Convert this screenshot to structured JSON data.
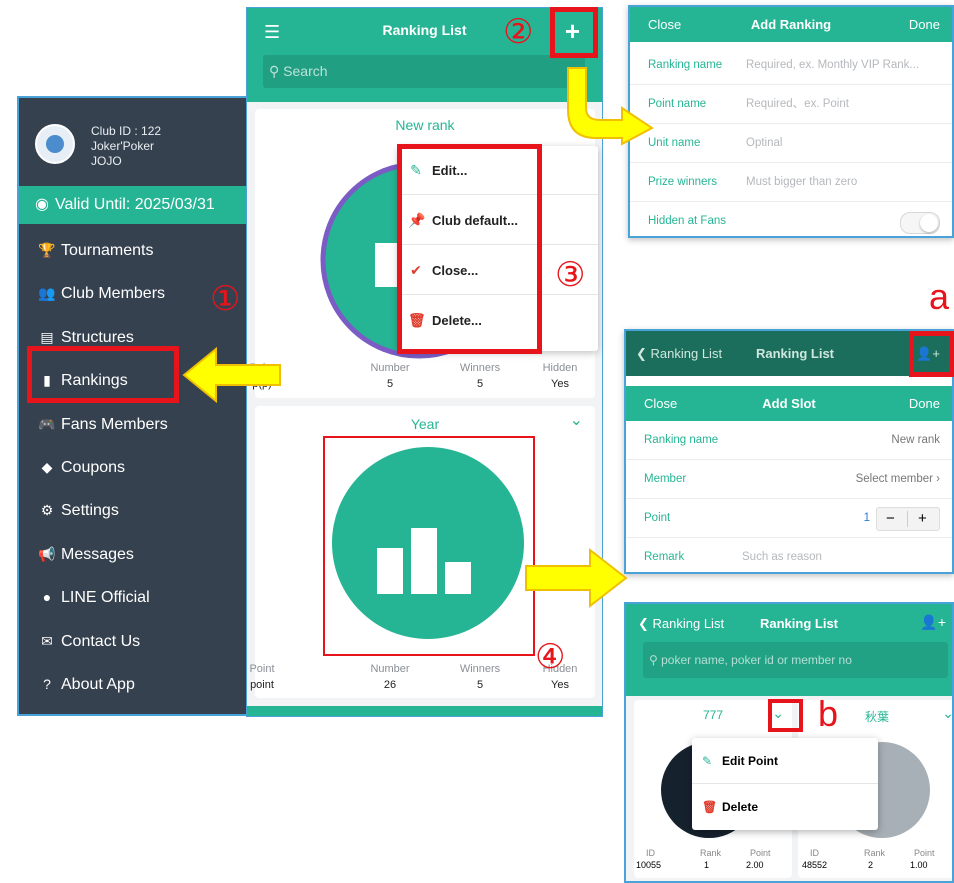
{
  "sidebar": {
    "club_id": "Club ID : 122",
    "club_name": "Joker'Poker",
    "club_user": "JOJO",
    "valid": "Valid Until: 2025/03/31",
    "items": [
      {
        "icon": "trophy-icon",
        "label": "Tournaments"
      },
      {
        "icon": "members-icon",
        "label": "Club Members"
      },
      {
        "icon": "structures-icon",
        "label": "Structures"
      },
      {
        "icon": "rankings-icon",
        "label": "Rankings"
      },
      {
        "icon": "gamepad-icon",
        "label": "Fans Members"
      },
      {
        "icon": "tag-icon",
        "label": "Coupons"
      },
      {
        "icon": "gear-icon",
        "label": "Settings"
      },
      {
        "icon": "megaphone-icon",
        "label": "Messages"
      },
      {
        "icon": "chat-icon",
        "label": "LINE Official"
      },
      {
        "icon": "mail-icon",
        "label": "Contact Us"
      },
      {
        "icon": "help-icon",
        "label": "About App"
      }
    ]
  },
  "ranking": {
    "title": "Ranking List",
    "search_placeholder": "Search",
    "card1": {
      "title": "New rank",
      "labels": [
        "Point",
        "Number",
        "Winners",
        "Hidden"
      ],
      "values": [
        "p(p)",
        "5",
        "5",
        "Yes"
      ]
    },
    "card2": {
      "title": "Year",
      "labels": [
        "Point",
        "Number",
        "Winners",
        "Hidden"
      ],
      "values": [
        "point",
        "26",
        "5",
        "Yes"
      ]
    },
    "menu": [
      "Edit...",
      "Club default...",
      "Close...",
      "Delete..."
    ]
  },
  "add_ranking": {
    "close": "Close",
    "title": "Add Ranking",
    "done": "Done",
    "rows": [
      {
        "label": "Ranking name",
        "placeholder": "Required, ex. Monthly VIP Rank..."
      },
      {
        "label": "Point name",
        "placeholder": "Required、ex. Point"
      },
      {
        "label": "Unit name",
        "placeholder": "Optinal"
      },
      {
        "label": "Prize winners",
        "placeholder": "Must bigger than zero"
      },
      {
        "label": "Hidden at Fans",
        "placeholder": ""
      }
    ]
  },
  "add_slot": {
    "back": "Ranking List",
    "bg_title": "Ranking List",
    "close": "Close",
    "title": "Add Slot",
    "done": "Done",
    "ranking_name_label": "Ranking name",
    "ranking_name_value": "New rank",
    "member_label": "Member",
    "member_value": "Select member",
    "point_label": "Point",
    "point_value": "1",
    "remark_label": "Remark",
    "remark_placeholder": "Such as reason"
  },
  "slot_list": {
    "back": "Ranking List",
    "title": "Ranking List",
    "search_placeholder": "poker name, poker id or member no",
    "card_left": {
      "name": "777",
      "id": "10055",
      "rank": "1",
      "point": "2.00"
    },
    "card_right": {
      "name": "秋葉",
      "id": "48552",
      "rank": "2",
      "point": "1.00"
    },
    "labels": [
      "ID",
      "Rank",
      "Point"
    ],
    "menu": [
      "Edit Point",
      "Delete"
    ]
  },
  "annotations": {
    "n1": "①",
    "n2": "②",
    "n3": "③",
    "n4": "④",
    "a": "a",
    "b": "b"
  },
  "colors": {
    "accent": "#26b594",
    "sidebar": "#36414f",
    "highlight": "#e8141b",
    "arrow": "#ffff00"
  }
}
